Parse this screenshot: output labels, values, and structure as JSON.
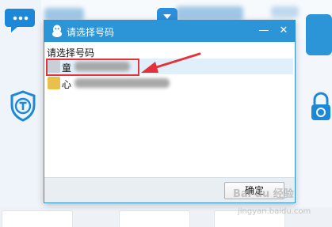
{
  "dialog": {
    "title": "请选择号码",
    "prompt": "请选择号码",
    "minimize_label": "—",
    "close_label": "✕",
    "ok_label": "确定"
  },
  "accounts": [
    {
      "name": "童",
      "selected": true,
      "avatar_color": "#c9cfd6"
    },
    {
      "name": "心",
      "selected": false,
      "avatar_color": "#e8c04a"
    }
  ],
  "icons": {
    "qq": "qq-penguin-icon",
    "chat": "chat-bubble-icon",
    "shield": "shield-t-icon",
    "lock": "lock-icon",
    "arrow": "annotation-arrow"
  },
  "watermark": {
    "brand": "Bai du 经验",
    "url": "jingyan.baidu.com"
  },
  "colors": {
    "title_bar": "#2b95d8",
    "highlight_box": "#e6303a",
    "arrow": "#e6303a"
  }
}
